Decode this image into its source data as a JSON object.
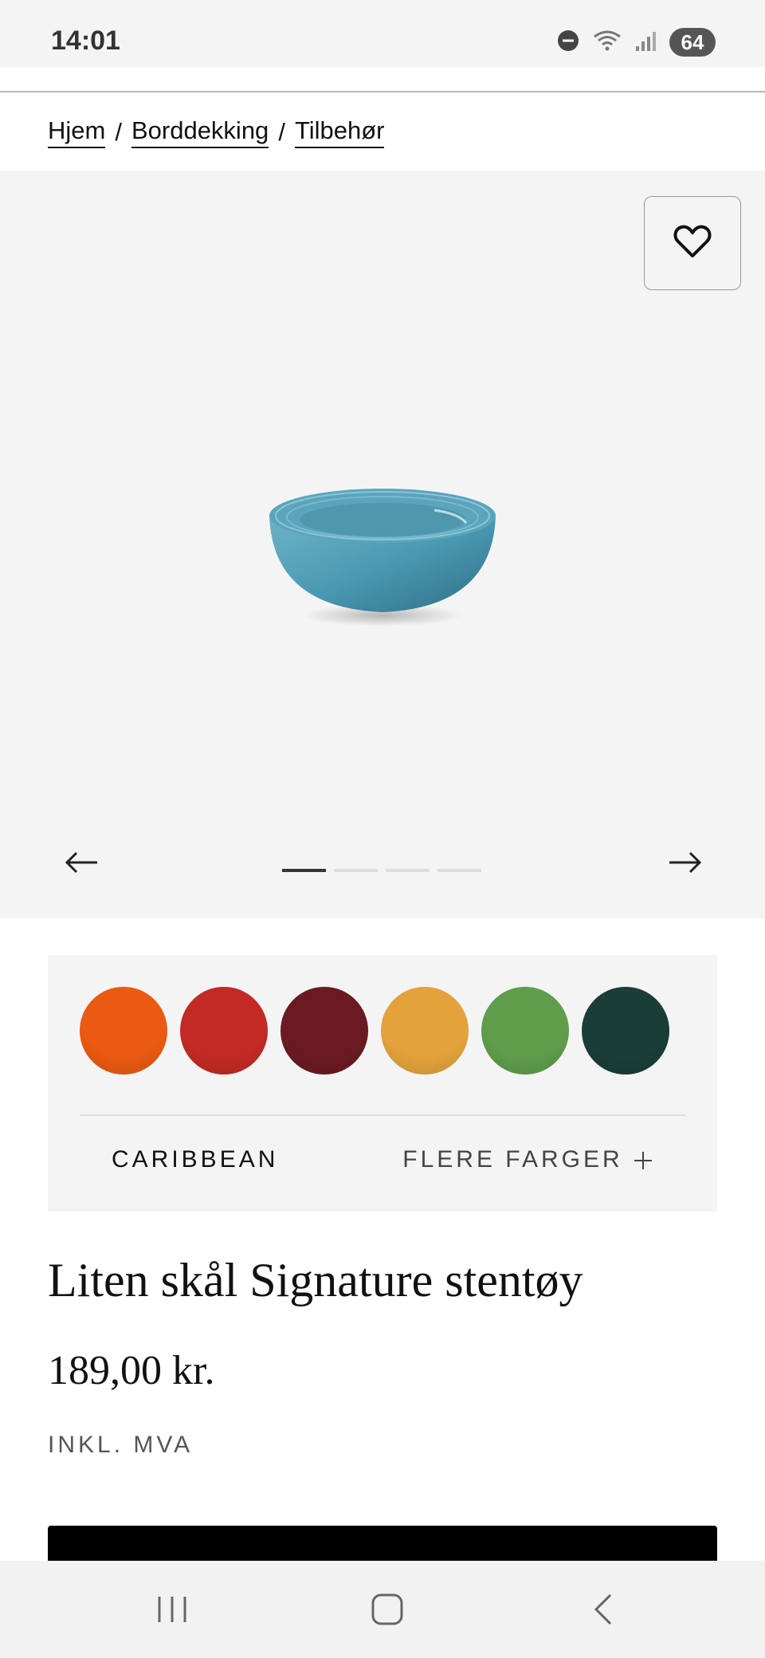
{
  "status_bar": {
    "time": "14:01",
    "battery": "64"
  },
  "breadcrumb": {
    "items": [
      "Hjem",
      "Borddekking",
      "Tilbehør"
    ],
    "separator": "/"
  },
  "gallery": {
    "slides": 4,
    "active_slide": 1,
    "favorite_icon": "heart-icon",
    "prev_icon": "arrow-left-icon",
    "next_icon": "arrow-right-icon"
  },
  "colors": {
    "swatches": [
      "#ea5a12",
      "#c32a25",
      "#6b1a22",
      "#e3a23c",
      "#5f9d4b",
      "#1b3d38"
    ],
    "selected_name": "CARIBBEAN",
    "more_label": "FLERE FARGER"
  },
  "product": {
    "title": "Liten skål Signature stentøy",
    "price": "189,00 kr.",
    "vat_note": "INKL. MVA"
  },
  "nav": {
    "icons": [
      "recent-apps-icon",
      "home-icon",
      "back-icon"
    ]
  }
}
